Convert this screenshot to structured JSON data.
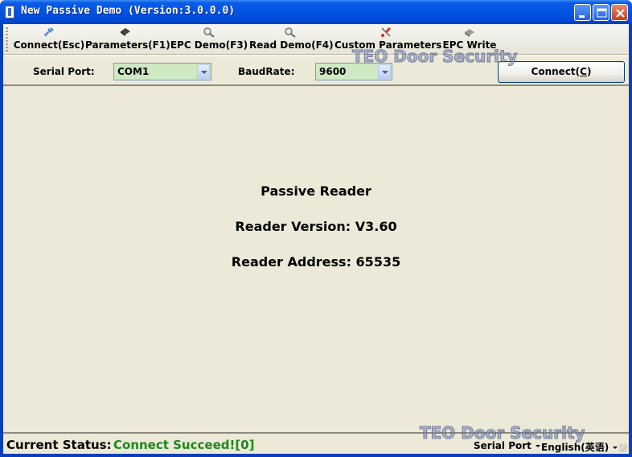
{
  "window": {
    "title": "New Passive Demo (Version:3.0.0.0)"
  },
  "toolbar": {
    "items": [
      {
        "label": "Connect(Esc)",
        "icon": "connect-icon"
      },
      {
        "label": "Parameters(F1)",
        "icon": "chip-icon"
      },
      {
        "label": "EPC Demo(F3)",
        "icon": "magnifier-icon"
      },
      {
        "label": "Read Demo(F4)",
        "icon": "magnifier-icon"
      },
      {
        "label": "Custom Parameters",
        "icon": "tools-icon"
      },
      {
        "label": "EPC Write",
        "icon": "eraser-icon"
      }
    ]
  },
  "connection": {
    "serial_port_label": "Serial Port:",
    "serial_port_value": "COM1",
    "baudrate_label": "BaudRate:",
    "baudrate_value": "9600",
    "connect_button_prefix": "Connect(",
    "connect_button_hotkey": "C",
    "connect_button_suffix": ")"
  },
  "reader": {
    "name": "Passive Reader",
    "version": "Reader Version: V3.60",
    "address": "Reader Address: 65535"
  },
  "status": {
    "label": "Current Status:",
    "value": "Connect Succeed![0]",
    "port_menu": "Serial Port",
    "language_menu": "English(英语)"
  },
  "watermarks": {
    "top": "TEO Door Security",
    "bottom": "TEO Door Security"
  },
  "colors": {
    "status_ok": "#1a8a1a",
    "combo_bg": "#cfe9c4"
  }
}
